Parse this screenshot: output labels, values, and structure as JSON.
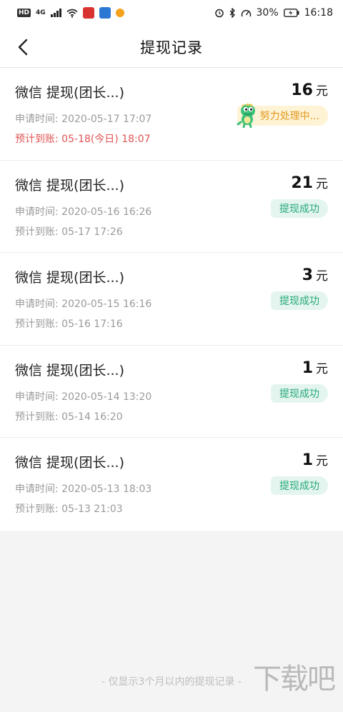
{
  "status_bar": {
    "left_badge": "HD",
    "network": "4G",
    "battery": "30%",
    "time": "16:18"
  },
  "header": {
    "title": "提现记录"
  },
  "records": [
    {
      "title": "微信 提现(团长...)",
      "amount": "16",
      "unit": "元",
      "applied": "申请时间: 2020-05-17 17:07",
      "expected": "预计到账: 05-18(今日) 18:07",
      "status": "努力处理中...",
      "status_type": "processing"
    },
    {
      "title": "微信 提现(团长...)",
      "amount": "21",
      "unit": "元",
      "applied": "申请时间: 2020-05-16 16:26",
      "expected": "预计到账: 05-17 17:26",
      "status": "提现成功",
      "status_type": "success"
    },
    {
      "title": "微信 提现(团长...)",
      "amount": "3",
      "unit": "元",
      "applied": "申请时间: 2020-05-15 16:16",
      "expected": "预计到账: 05-16 17:16",
      "status": "提现成功",
      "status_type": "success"
    },
    {
      "title": "微信 提现(团长...)",
      "amount": "1",
      "unit": "元",
      "applied": "申请时间: 2020-05-14 13:20",
      "expected": "预计到账: 05-14 16:20",
      "status": "提现成功",
      "status_type": "success"
    },
    {
      "title": "微信 提现(团长...)",
      "amount": "1",
      "unit": "元",
      "applied": "申请时间: 2020-05-13 18:03",
      "expected": "预计到账: 05-13 21:03",
      "status": "提现成功",
      "status_type": "success"
    }
  ],
  "footer_note": "- 仅显示3个月以内的提现记录 -",
  "watermark": "下载吧",
  "colors": {
    "success_text": "#26a87a",
    "success_bg": "#e3f5ee",
    "processing_text": "#e39a1e",
    "processing_bg": "#fff3d6",
    "alert_text": "#e05454"
  },
  "icons": {
    "back": "chevron-left-icon",
    "mascot": "dinosaur-mascot-icon"
  }
}
